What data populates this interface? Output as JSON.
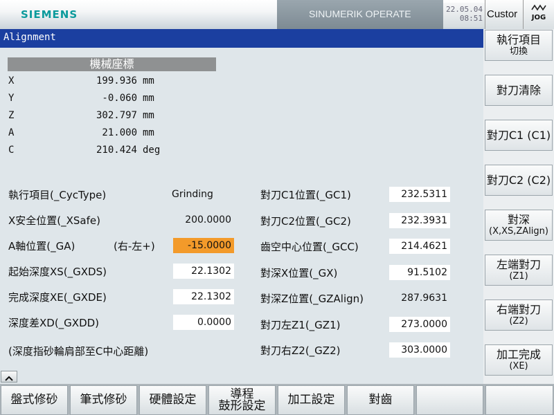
{
  "header": {
    "brand": "SIEMENS",
    "product": "SINUMERIK OPERATE",
    "date": "22.05.04",
    "time": "08:51",
    "area_tab": "Custor",
    "mode_tab": "JOG"
  },
  "window_title": "Alignment",
  "coordinates": {
    "header": "機械座標",
    "rows": [
      {
        "axis": "X",
        "value": "199.936",
        "unit": "mm"
      },
      {
        "axis": "Y",
        "value": "-0.060",
        "unit": "mm"
      },
      {
        "axis": "Z",
        "value": "302.797",
        "unit": "mm"
      },
      {
        "axis": "A",
        "value": "21.000",
        "unit": "mm"
      },
      {
        "axis": "C",
        "value": "210.424",
        "unit": "deg"
      }
    ]
  },
  "params_left": [
    {
      "label": "執行項目(_CycType)",
      "value": "Grinding",
      "style": "plain"
    },
    {
      "label": "X安全位置(_XSafe)",
      "value": "200.0000",
      "style": "plain"
    },
    {
      "label": "A軸位置(_GA)",
      "extra": "(右-左+)",
      "value": "-15.0000",
      "style": "active"
    },
    {
      "label": "起始深度XS(_GXDS)",
      "value": "22.1302",
      "style": "box"
    },
    {
      "label": "完成深度XE(_GXDE)",
      "value": "22.1302",
      "style": "box"
    },
    {
      "label": "深度差XD(_GXDD)",
      "value": "0.0000",
      "style": "box"
    }
  ],
  "note": "(深度指砂輪肩部至C中心距離)",
  "params_right": [
    {
      "label": "對刀C1位置(_GC1)",
      "value": "232.5311",
      "style": "box"
    },
    {
      "label": "對刀C2位置(_GC2)",
      "value": "232.3931",
      "style": "box"
    },
    {
      "label": "齒空中心位置(_GCC)",
      "value": "214.4621",
      "style": "box"
    },
    {
      "label": "對深X位置(_GX)",
      "value": "91.5102",
      "style": "box"
    },
    {
      "label": "對深Z位置(_GZAlign)",
      "value": "287.9631",
      "style": "plain"
    },
    {
      "label": "對刀左Z1(_GZ1)",
      "value": "273.0000",
      "style": "box"
    },
    {
      "label": "對刀右Z2(_GZ2)",
      "value": "303.0000",
      "style": "box"
    }
  ],
  "right_softkeys": [
    {
      "line1": "執行項目",
      "line2": "切換"
    },
    {
      "line1": "對刀清除",
      "line2": ""
    },
    {
      "line1": "對刀C1 (C1)",
      "line2": ""
    },
    {
      "line1": "對刀C2 (C2)",
      "line2": ""
    },
    {
      "line1": "對深",
      "line2": "(X,XS,ZAlign)"
    },
    {
      "line1": "左端對刀",
      "line2": "(Z1)"
    },
    {
      "line1": "右端對刀",
      "line2": "(Z2)"
    },
    {
      "line1": "加工完成",
      "line2": "(XE)"
    }
  ],
  "horizontal_softkeys": [
    {
      "line1": "盤式修砂",
      "line2": ""
    },
    {
      "line1": "筆式修砂",
      "line2": ""
    },
    {
      "line1": "硬體設定",
      "line2": ""
    },
    {
      "line1": "導程",
      "line2": "鼓形設定"
    },
    {
      "line1": "加工設定",
      "line2": ""
    },
    {
      "line1": "對齒",
      "line2": ""
    },
    {
      "line1": "",
      "line2": ""
    },
    {
      "line1": "",
      "line2": ""
    }
  ],
  "colors": {
    "title_bar": "#1b3fa0",
    "active_field": "#f39a2a",
    "brand": "#0b9a9c"
  }
}
